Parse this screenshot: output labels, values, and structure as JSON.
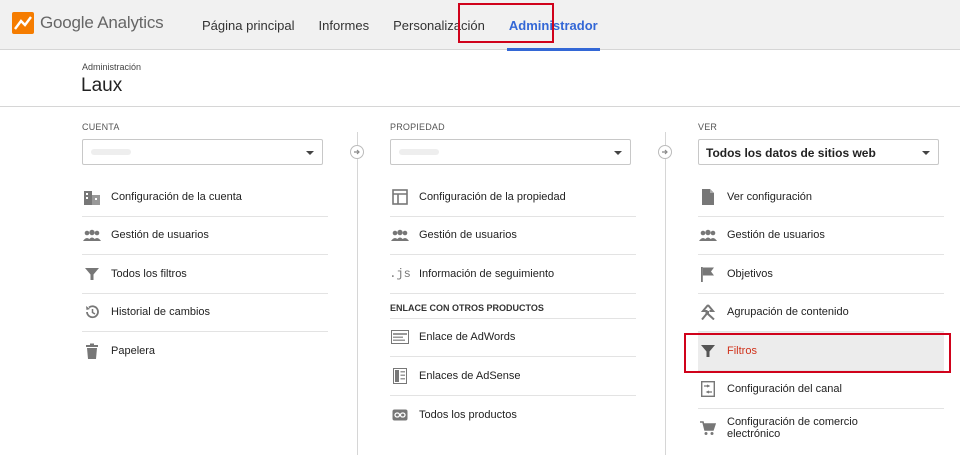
{
  "app": {
    "logo_google": "Google",
    "logo_product": "Analytics",
    "brand_color": "#f57c00"
  },
  "nav": {
    "items": [
      {
        "label": "Página principal"
      },
      {
        "label": "Informes"
      },
      {
        "label": "Personalización"
      },
      {
        "label": "Administrador",
        "active": true
      }
    ]
  },
  "header": {
    "breadcrumb": "Administración",
    "title": "Laux"
  },
  "columns": {
    "account": {
      "label": "CUENTA",
      "selected": "",
      "items": [
        {
          "label": "Configuración de la cuenta",
          "icon": "building-icon"
        },
        {
          "label": "Gestión de usuarios",
          "icon": "users-icon"
        },
        {
          "label": "Todos los filtros",
          "icon": "filter-icon"
        },
        {
          "label": "Historial de cambios",
          "icon": "history-icon"
        },
        {
          "label": "Papelera",
          "icon": "trash-icon"
        }
      ]
    },
    "property": {
      "label": "PROPIEDAD",
      "selected": "",
      "items": [
        {
          "label": "Configuración de la propiedad",
          "icon": "window-icon"
        },
        {
          "label": "Gestión de usuarios",
          "icon": "users-icon"
        },
        {
          "label": "Información de seguimiento",
          "icon": "js-icon"
        }
      ],
      "section": "ENLACE CON OTROS PRODUCTOS",
      "linked": [
        {
          "label": "Enlace de AdWords",
          "icon": "adwords-icon"
        },
        {
          "label": "Enlaces de AdSense",
          "icon": "adsense-icon"
        },
        {
          "label": "Todos los productos",
          "icon": "link-icon"
        }
      ]
    },
    "view": {
      "label": "VER",
      "selected": "Todos los datos de sitios web",
      "items": [
        {
          "label": "Ver configuración",
          "icon": "document-icon"
        },
        {
          "label": "Gestión de usuarios",
          "icon": "users-icon"
        },
        {
          "label": "Objetivos",
          "icon": "flag-icon"
        },
        {
          "label": "Agrupación de contenido",
          "icon": "grouping-icon"
        },
        {
          "label": "Filtros",
          "icon": "filter-icon",
          "active": true
        },
        {
          "label": "Configuración del canal",
          "icon": "channel-icon"
        },
        {
          "label": "Configuración de comercio electrónico",
          "icon": "cart-icon"
        }
      ]
    }
  },
  "colors": {
    "active_nav": "#3367d6",
    "highlight": "#d0021b",
    "active_item_text": "#d0321b"
  }
}
